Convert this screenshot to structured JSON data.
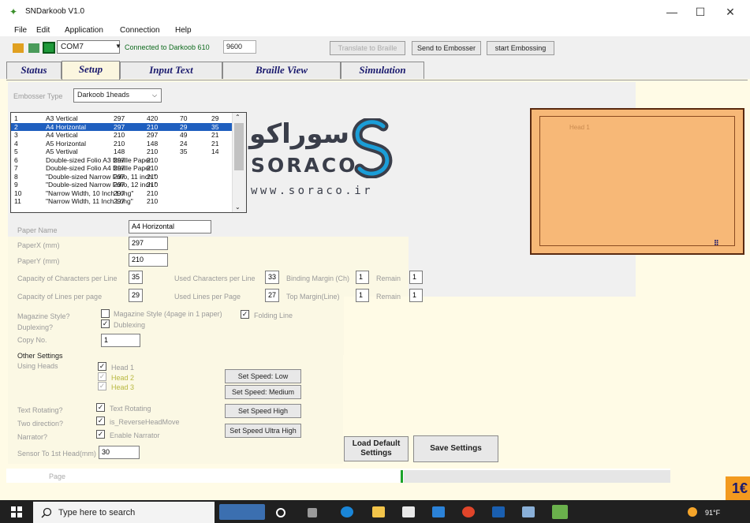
{
  "window": {
    "title": "SNDarkoob V1.0",
    "controls": {
      "minimize": "—",
      "maximize": "☐",
      "close": "✕"
    }
  },
  "menu": [
    "File",
    "Edit",
    "Application",
    "Connection",
    "Help"
  ],
  "toolbar": {
    "port": "COM7",
    "connection_status": "Connected to Darkoob 610",
    "baud": "9600",
    "translate_label": "Translate to Braille",
    "send_label": "Send to Embosser",
    "start_label": "start Embossing"
  },
  "tabs": [
    "Status",
    "Setup",
    "Input Text",
    "Braille View",
    "Simulation"
  ],
  "active_tab": "Setup",
  "setup": {
    "embosser_type_label": "Embosser Type",
    "embosser_type_value": "Darkoob 1heads",
    "paper_list": [
      {
        "no": "1",
        "name": "A3 Vertical",
        "w": "297",
        "h": "420",
        "c": "70",
        "l": "29"
      },
      {
        "no": "2",
        "name": "A4 Horizontal",
        "w": "297",
        "h": "210",
        "c": "29",
        "l": "35"
      },
      {
        "no": "3",
        "name": "A4 Vertical",
        "w": "210",
        "h": "297",
        "c": "49",
        "l": "21"
      },
      {
        "no": "4",
        "name": "A5 Horizontal",
        "w": "210",
        "h": "148",
        "c": "24",
        "l": "21"
      },
      {
        "no": "5",
        "name": "A5 Vertival",
        "w": "148",
        "h": "210",
        "c": "35",
        "l": "14"
      },
      {
        "no": "6",
        "name": "Double-sized Folio A3 Braille Paper",
        "w": "297",
        "h": "210",
        "c": "",
        "l": ""
      },
      {
        "no": "7",
        "name": "Double-sized Folio A4 Braille Paper",
        "w": "297",
        "h": "210",
        "c": "",
        "l": ""
      },
      {
        "no": "8",
        "name": "\"Double-sized Narrow Folio, 11 inch \"",
        "w": "297",
        "h": "210",
        "c": "",
        "l": ""
      },
      {
        "no": "9",
        "name": "\"Double-sized Narrow Folio, 12 inch \"",
        "w": "297",
        "h": "210",
        "c": "",
        "l": ""
      },
      {
        "no": "10",
        "name": "\"Narrow Width, 10 Inch Long\"",
        "w": "297",
        "h": "210",
        "c": "",
        "l": ""
      },
      {
        "no": "11",
        "name": "\"Narrow Width, 11 Inch Long\"",
        "w": "297",
        "h": "210",
        "c": "",
        "l": ""
      }
    ],
    "selected_index": 1,
    "paper_name_label": "Paper Name",
    "paper_name": "A4 Horizontal",
    "paperx_label": "PaperX (mm)",
    "paperx": "297",
    "papery_label": "PaperY (mm)",
    "papery": "210",
    "cap_chars_label": "Capacity of Characters per Line",
    "cap_chars": "35",
    "used_chars_label": "Used Characters per Line",
    "used_chars": "33",
    "binding_label": "Binding Margin (Ch)",
    "binding": "1",
    "remain_label": "Remain",
    "remain_chars": "1",
    "cap_lines_label": "Capacity of Lines per page",
    "cap_lines": "29",
    "used_lines_label": "Used Lines per Page",
    "used_lines": "27",
    "top_margin_label": "Top Margin(Line)",
    "top_margin": "1",
    "remain_lines": "1",
    "magazine_label": "Magazine Style?",
    "magazine_opt": "Magazine Style (4page in 1 paper)",
    "folding_opt": "Folding Line",
    "duplexing_label": "Duplexing?",
    "duplexing_opt": "Dublexing",
    "copy_label": "Copy No.",
    "copy_no": "1",
    "other_settings": "Other Settings",
    "using_heads_label": "Using Heads",
    "heads": [
      "Head 1",
      "Head 2",
      "Head 3"
    ],
    "speed_buttons": [
      "Set Speed: Low",
      "Set Speed: Medium",
      "Set Speed High",
      "Set Speed Ultra High"
    ],
    "text_rotating_label": "Text Rotating?",
    "text_rotating_opt": "Text Rotating",
    "two_direction_label": "Two direction?",
    "two_direction_opt": "is_ReverseHeadMove",
    "narrator_label": "Narrator?",
    "narrator_opt": "Enable Narrator",
    "sensor_label": "Sensor To 1st Head(mm)",
    "sensor_value": "30",
    "load_default_label": "Load Default Settings",
    "save_label": "Save Settings"
  },
  "logo": {
    "arabic": "سوراکو",
    "latin": "SORACO",
    "url": "www.soraco.ir"
  },
  "preview": {
    "head_label": "Head 1",
    "grip": "⠿"
  },
  "status": {
    "page_label": "Page"
  },
  "badge": "1€",
  "taskbar": {
    "search_placeholder": "Type here to search",
    "temperature": "91°F"
  },
  "colors": {
    "accent": "#1f5fbf",
    "preview_fill": "#f7b877",
    "connected": "#0f6b1e"
  }
}
